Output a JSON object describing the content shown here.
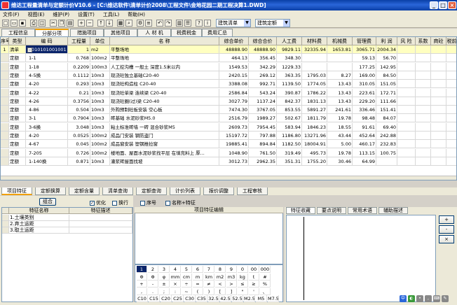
{
  "window": {
    "title": "维达工程量清单与定额计价V10.6 - [C:\\维达软件\\清单计价2008\\工程文件\\金地花园二期工程决算1.DWD]",
    "min_label": "_",
    "max_label": "□",
    "close_label": "×"
  },
  "menu": {
    "items": [
      "文件(F)",
      "视图(E)",
      "维护(P)",
      "设置(T)",
      "工具(L)",
      "帮助(H)"
    ]
  },
  "toolbar": {
    "mode_select": "建筑清单",
    "quota_select": "建筑定额"
  },
  "top_tabs": [
    "工程信息",
    "分部分项",
    "措施项目",
    "其他项目",
    "人 材 机",
    "税费税金",
    "费用汇总"
  ],
  "grid": {
    "columns": [
      "序号",
      "类型",
      "编    码",
      "工程量",
      "单位",
      "名    称",
      "综合单价",
      "综合合价",
      "人工费",
      "材料费",
      "机械费",
      "管理费",
      "利 润",
      "风 险",
      "系数",
      "商砼",
      "税前"
    ],
    "rows": [
      {
        "seq": "1",
        "type": "清单",
        "code": "010101001001",
        "qty": "1",
        "unit": "m2",
        "name": "平整场地",
        "price": "48888.90",
        "total": "48888.90",
        "labor": "9829.11",
        "material": "32335.94",
        "machine": "1653.81",
        "mgmt": "3065.71",
        "profit": "2004.34",
        "risk": "",
        "coef": "",
        "conc": "",
        "tax": ""
      },
      {
        "seq": "",
        "type": "定额",
        "code": "1-1",
        "qty": "0.768",
        "unit": "100m2",
        "name": "平整场地",
        "price": "464.13",
        "total": "356.45",
        "labor": "348.30",
        "material": "",
        "machine": "",
        "mgmt": "59.13",
        "profit": "56.70",
        "risk": "",
        "coef": "",
        "conc": "",
        "tax": ""
      },
      {
        "seq": "",
        "type": "定额",
        "code": "1-18",
        "qty": "0.2209",
        "unit": "100m3",
        "name": "人工挖沟槽 一般土 深度1.5米以内",
        "price": "1549.53",
        "total": "342.29",
        "labor": "1229.33",
        "material": "",
        "machine": "",
        "mgmt": "177.25",
        "profit": "142.95",
        "risk": "",
        "coef": "",
        "conc": "",
        "tax": ""
      },
      {
        "seq": "",
        "type": "定额",
        "code": "4-5换",
        "qty": "0.1112",
        "unit": "10m3",
        "name": "现浇砼独立基础C20-40",
        "price": "2420.15",
        "total": "269.12",
        "labor": "363.35",
        "material": "1795.03",
        "machine": "8.27",
        "mgmt": "169.00",
        "profit": "84.50",
        "risk": "",
        "coef": "",
        "conc": "",
        "tax": ""
      },
      {
        "seq": "",
        "type": "定额",
        "code": "4-20",
        "qty": "0.293",
        "unit": "10m3",
        "name": "现浇砼构造柱 C20-40",
        "price": "3388.08",
        "total": "992.71",
        "labor": "1139.50",
        "material": "1774.05",
        "machine": "13.43",
        "mgmt": "310.05",
        "profit": "151.05",
        "risk": "",
        "coef": "",
        "conc": "",
        "tax": ""
      },
      {
        "seq": "",
        "type": "定额",
        "code": "4-22",
        "qty": "0.21",
        "unit": "10m3",
        "name": "现浇砼单梁 连续梁 C20-40",
        "price": "2586.84",
        "total": "543.24",
        "labor": "390.87",
        "material": "1786.22",
        "machine": "13.43",
        "mgmt": "223.61",
        "profit": "172.71",
        "risk": "",
        "coef": "",
        "conc": "",
        "tax": ""
      },
      {
        "seq": "",
        "type": "定额",
        "code": "4-26",
        "qty": "0.3756",
        "unit": "10m3",
        "name": "现浇砼圈(过)梁 C20-40",
        "price": "3027.79",
        "total": "1137.24",
        "labor": "842.37",
        "material": "1831.13",
        "machine": "13.43",
        "mgmt": "229.20",
        "profit": "111.66",
        "risk": "",
        "coef": "",
        "conc": "",
        "tax": ""
      },
      {
        "seq": "",
        "type": "定额",
        "code": "4-86",
        "qty": "0.504",
        "unit": "10m3",
        "name": "外购预制砼板安装 空心板",
        "price": "7474.30",
        "total": "3767.05",
        "labor": "853.55",
        "material": "5891.27",
        "machine": "241.61",
        "mgmt": "336.46",
        "profit": "151.41",
        "risk": "",
        "coef": "",
        "conc": "",
        "tax": ""
      },
      {
        "seq": "",
        "type": "定额",
        "code": "3-1",
        "qty": "0.7904",
        "unit": "10m3",
        "name": "砖基础 水泥砂浆M5.0",
        "price": "2516.79",
        "total": "1989.27",
        "labor": "502.67",
        "material": "1811.79",
        "machine": "19.78",
        "mgmt": "98.48",
        "profit": "84.07",
        "risk": "",
        "coef": "",
        "conc": "",
        "tax": ""
      },
      {
        "seq": "",
        "type": "定额",
        "code": "3-6换",
        "qty": "3.048",
        "unit": "10m3",
        "name": "粘土标准砖墙 一砖 混合砂浆M5",
        "price": "2609.73",
        "total": "7954.45",
        "labor": "583.94",
        "material": "1846.23",
        "machine": "18.55",
        "mgmt": "91.61",
        "profit": "69.40",
        "risk": "",
        "coef": "",
        "conc": "",
        "tax": ""
      },
      {
        "seq": "",
        "type": "定额",
        "code": "4-20",
        "qty": "0.0525",
        "unit": "100m2",
        "name": "成品门安装 钢防盗门",
        "price": "15197.72",
        "total": "797.88",
        "labor": "1186.80",
        "material": "13271.96",
        "machine": "43.44",
        "mgmt": "452.64",
        "profit": "242.88",
        "risk": "",
        "coef": "",
        "conc": "",
        "tax": ""
      },
      {
        "seq": "",
        "type": "定额",
        "code": "4-67",
        "qty": "0.045",
        "unit": "100m2",
        "name": "成品窗安装 塑钢推拉窗",
        "price": "19885.41",
        "total": "894.84",
        "labor": "1182.50",
        "material": "18004.91",
        "machine": "5.00",
        "mgmt": "460.17",
        "profit": "232.83",
        "risk": "",
        "coef": "",
        "conc": "",
        "tax": ""
      },
      {
        "seq": "",
        "type": "定额",
        "code": "7-205",
        "qty": "0.726",
        "unit": "100m2",
        "name": "楼地面、屋面水泥砂浆找平层 在填充料上 厚...",
        "price": "1048.90",
        "total": "761.50",
        "labor": "319.49",
        "material": "495.73",
        "machine": "19.78",
        "mgmt": "113.15",
        "profit": "100.75",
        "risk": "",
        "coef": "",
        "conc": "",
        "tax": ""
      },
      {
        "seq": "",
        "type": "定额",
        "code": "1-140换",
        "qty": "0.871",
        "unit": "10m3",
        "name": "灌浆砖屋面找坡",
        "price": "3012.73",
        "total": "2962.35",
        "labor": "351.31",
        "material": "1755.20",
        "machine": "30.46",
        "mgmt": "64.99",
        "profit": "",
        "risk": "",
        "coef": "",
        "conc": "",
        "tax": ""
      }
    ]
  },
  "bottom_tabs": [
    "项目特征",
    "定额换算",
    "定额含量",
    "清单查询",
    "定额查询",
    "计价列表",
    "报价调整",
    "工程审核"
  ],
  "feature_panel": {
    "combine_button": "组合",
    "checks": [
      {
        "label": "优化",
        "checked": true
      },
      {
        "label": "换行",
        "checked": false
      },
      {
        "label": "序号",
        "checked": false
      },
      {
        "label": "名称+特征",
        "checked": false
      }
    ],
    "col_name": "特征名称",
    "col_desc": "特征描述",
    "rows": [
      "1.土壤类别",
      "2.弃土运距",
      "3.取土运距"
    ]
  },
  "editor": {
    "header": "项目特征编辑"
  },
  "keypad": {
    "rows": [
      [
        "1",
        "2",
        "3",
        "4",
        "5",
        "6",
        "7",
        "8",
        "9",
        "0",
        "00",
        "000"
      ],
      [
        "Φ",
        "Φ",
        "φ",
        "mm",
        "cm",
        "m",
        "km",
        "m2",
        "m3",
        "kg",
        "t",
        "#"
      ],
      [
        "+",
        "-",
        "±",
        "×",
        "÷",
        "=",
        "≠",
        "<",
        ">",
        "≤",
        "≥",
        "%"
      ],
      [
        ",",
        ".",
        ";",
        ":",
        "~",
        "(",
        ")",
        "[",
        "]",
        "\"",
        "'",
        "、"
      ],
      [
        "C10",
        "C15",
        "C20",
        "C25",
        "C30",
        "C35",
        "32.5",
        "42.5",
        "52.5",
        "M2.5",
        "M5",
        "M7.5"
      ]
    ]
  },
  "right_panel": {
    "tabs": [
      "特征收藏",
      "要点说明",
      "常用术语",
      "辅助描述"
    ],
    "plus_button": "+",
    "minus_button": "-",
    "delete_button": "×"
  },
  "tray": {
    "ime_label": "中"
  }
}
